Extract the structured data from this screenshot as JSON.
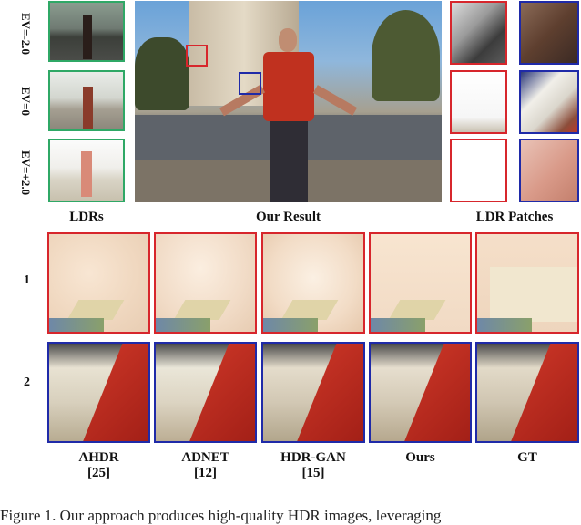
{
  "ldr_exposures": [
    "EV=-2.0",
    "EV=0",
    "EV=+2.0"
  ],
  "section_labels": {
    "ldrs": "LDRs",
    "result": "Our Result",
    "patches": "LDR Patches"
  },
  "row_labels": [
    "1",
    "2"
  ],
  "methods": [
    {
      "name": "AHDR",
      "ref": "[25]"
    },
    {
      "name": "ADNET",
      "ref": "[12]"
    },
    {
      "name": "HDR-GAN",
      "ref": "[15]"
    },
    {
      "name": "Ours",
      "ref": ""
    },
    {
      "name": "GT",
      "ref": ""
    }
  ],
  "caption": "Figure 1. Our approach produces high-quality HDR images, leveraging"
}
